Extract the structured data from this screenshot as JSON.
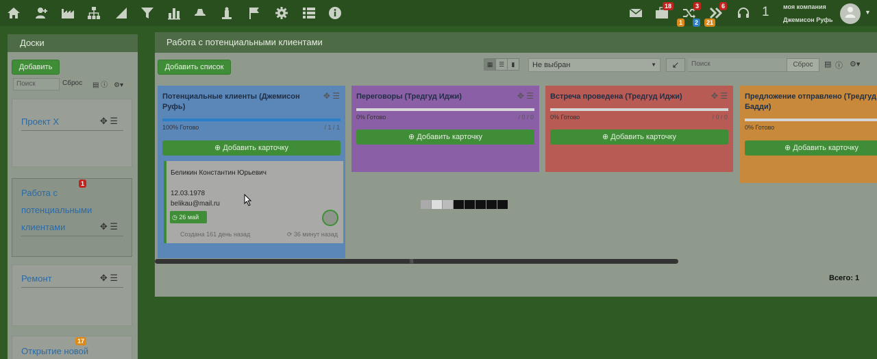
{
  "topbar": {
    "icons": [
      "home-icon",
      "users-icon",
      "factory-icon",
      "org-structure-icon",
      "signal-icon",
      "filter-icon",
      "chart-icon",
      "hat-icon",
      "scales-icon",
      "flag-icon",
      "gear-icon",
      "list-icon",
      "info-icon"
    ],
    "mail_icon": "mail-icon",
    "briefcase_badge": "18",
    "briefcase_sub_badge": "1",
    "shuffle_badge": "3",
    "shuffle_sub_badge": "2",
    "forward_badge": "6",
    "forward_sub_badge": "21",
    "headset_count": "1",
    "company": "моя компания",
    "user": "Джемисон Руфь"
  },
  "left_panel": {
    "title": "Доски",
    "add_label": "Добавить",
    "search_placeholder": "Поиск",
    "reset_label": "Сброс",
    "boards": [
      {
        "name": "Проект Х",
        "badge": ""
      },
      {
        "name_lines": [
          "Работа с",
          "потенциальными",
          "клиентами"
        ],
        "badge": "1"
      },
      {
        "name": "Ремонт",
        "badge": ""
      },
      {
        "name": "Открытие новой",
        "badge": "17"
      }
    ]
  },
  "main": {
    "title": "Работа с потенциальными клиентами",
    "add_list_label": "Добавить список",
    "select_value": "Не выбран",
    "search_placeholder": "Поиск",
    "reset_label": "Сброс",
    "columns": [
      {
        "title": "Потенциальные клиенты (Джемисон Руфь)",
        "progress_label": "100% Готово",
        "progress": 1.0,
        "count": "/ 1 / 1",
        "add_card_label": "Добавить карточку",
        "color": "#5b86b8"
      },
      {
        "title": "Переговоры (Тредгуд Иджи)",
        "progress_label": "0% Готово",
        "progress": 0,
        "count": "/ 0 / 0",
        "add_card_label": "Добавить карточку",
        "color": "#8a5fa6"
      },
      {
        "title": "Встреча проведена (Тредгуд Иджи)",
        "progress_label": "0% Готово",
        "progress": 0,
        "count": "/ 0 / 0",
        "add_card_label": "Добавить карточку",
        "color": "#b95b55"
      },
      {
        "title": "Предложение отправлено (Тредгуд Бадди)",
        "progress_label": "0% Готово",
        "progress": 0,
        "count": "",
        "add_card_label": "Добавить карточку",
        "color": "#c9893a"
      }
    ],
    "card": {
      "name": "Беликин Константин Юрьевич",
      "date": "12.03.1978",
      "email": "belikau@mail.ru",
      "due": "26 май",
      "created": "Создана 161 день назад",
      "updated": "36 минут назад"
    },
    "total_label": "Всего: 1"
  }
}
